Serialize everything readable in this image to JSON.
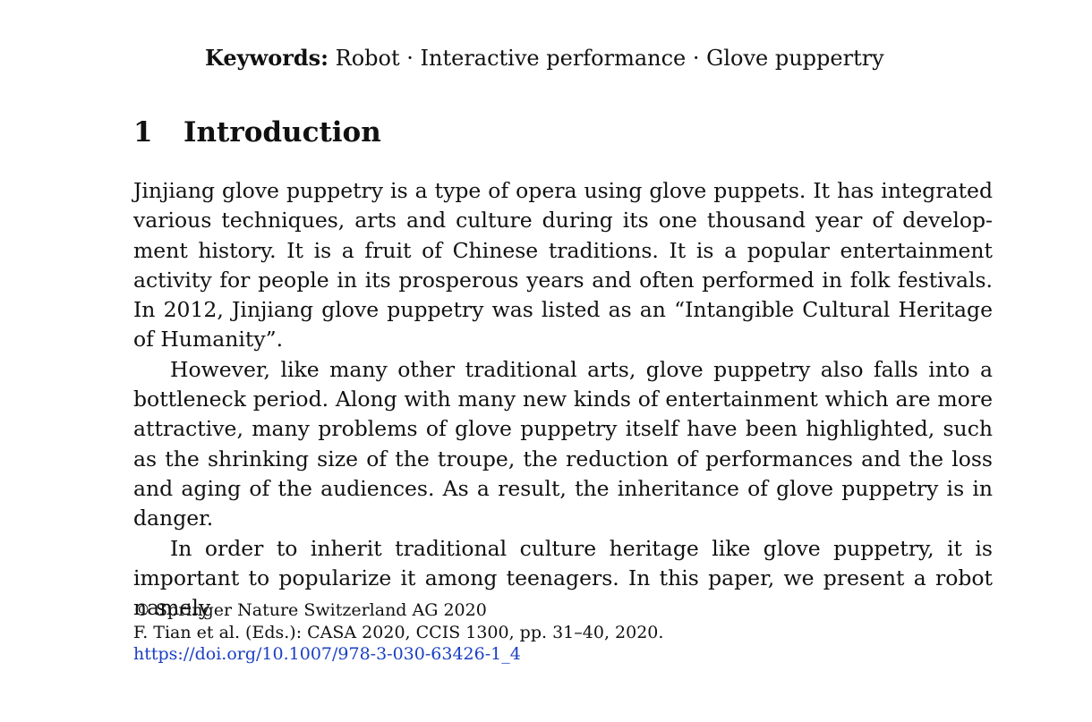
{
  "keywords": {
    "label": "Keywords:",
    "items": [
      "Robot",
      "Interactive performance",
      "Glove puppertry"
    ],
    "separator": " · "
  },
  "section": {
    "number": "1",
    "title": "Introduction"
  },
  "paragraphs": [
    "Jinjiang glove puppetry is a type of opera using glove puppets. It has integrated various techniques, arts and culture during its one thousand year of develop­ment history. It is a fruit of Chinese traditions. It is a popular entertainment activity for people in its prosperous years and often performed in folk festivals. In 2012, Jinjiang glove puppetry was listed as an “Intangible Cultural Heritage of Humanity”.",
    "However, like many other traditional arts, glove puppetry also falls into a bottleneck period. Along with many new kinds of entertainment which are more attractive, many problems of glove puppetry itself have been highlighted, such as the shrinking size of the troupe, the reduction of performances and the loss and aging of the audiences. As a result, the inheritance of glove puppetry is in danger.",
    "In order to inherit traditional culture heritage like glove puppetry, it is impor­tant to popularize it among teenagers. In this paper, we present a robot namely"
  ],
  "footer": {
    "copyright": "© Springer Nature Switzerland AG 2020",
    "citation": "F. Tian et al. (Eds.): CASA 2020, CCIS 1300, pp. 31–40, 2020.",
    "doi": "https://doi.org/10.1007/978-3-030-63426-1_4"
  }
}
